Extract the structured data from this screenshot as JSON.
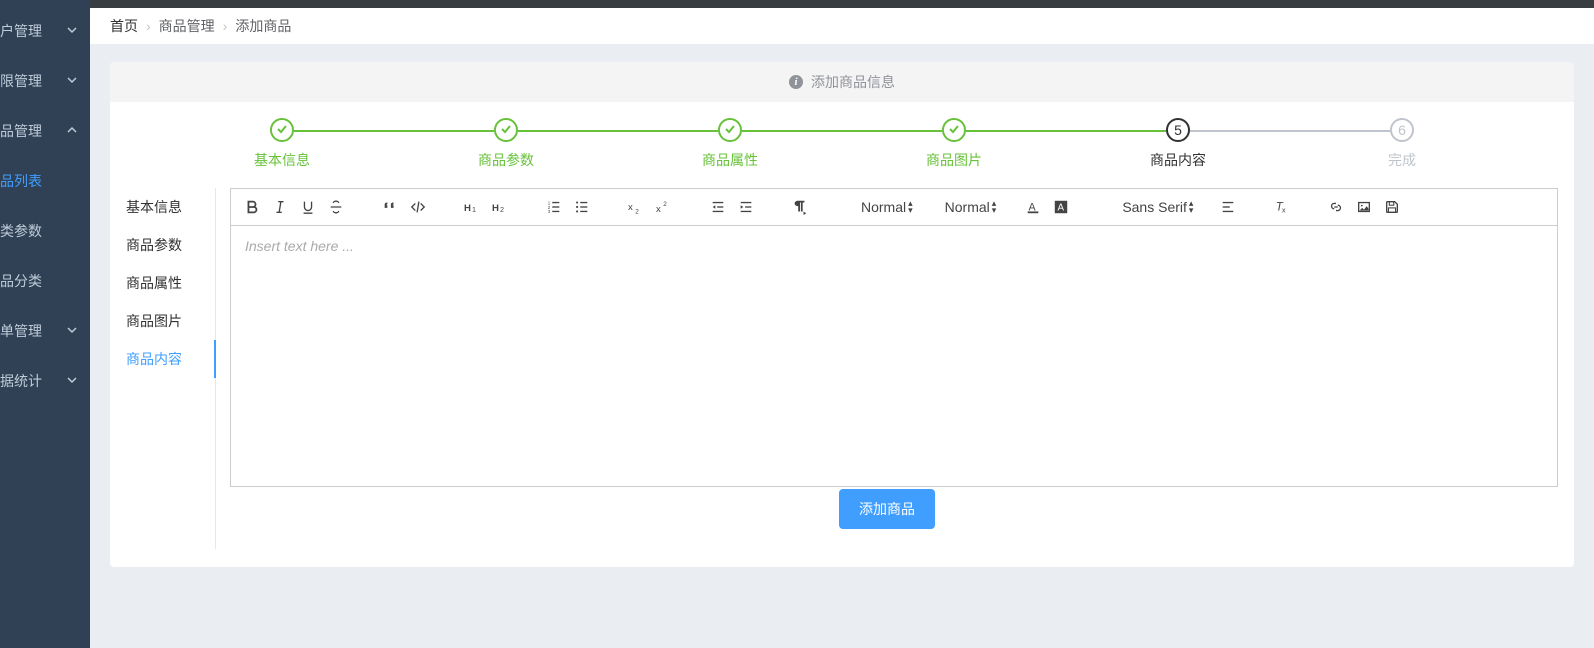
{
  "sidebar": {
    "items": [
      {
        "label": "户管理",
        "expandable": true,
        "active": false
      },
      {
        "label": "限管理",
        "expandable": true,
        "active": false
      },
      {
        "label": "品管理",
        "expandable": true,
        "active": false,
        "open": true
      },
      {
        "label": "品列表",
        "expandable": false,
        "active": true
      },
      {
        "label": "类参数",
        "expandable": false,
        "active": false
      },
      {
        "label": "品分类",
        "expandable": false,
        "active": false
      },
      {
        "label": "单管理",
        "expandable": true,
        "active": false
      },
      {
        "label": "据统计",
        "expandable": true,
        "active": false
      }
    ]
  },
  "breadcrumb": {
    "home": "首页",
    "mid": "商品管理",
    "last": "添加商品"
  },
  "alert": {
    "text": "添加商品信息"
  },
  "steps": [
    {
      "label": "基本信息",
      "state": "done"
    },
    {
      "label": "商品参数",
      "state": "done"
    },
    {
      "label": "商品属性",
      "state": "done"
    },
    {
      "label": "商品图片",
      "state": "done"
    },
    {
      "label": "商品内容",
      "state": "current",
      "num": "5"
    },
    {
      "label": "完成",
      "state": "future",
      "num": "6"
    }
  ],
  "tabs": [
    {
      "label": "基本信息"
    },
    {
      "label": "商品参数"
    },
    {
      "label": "商品属性"
    },
    {
      "label": "商品图片"
    },
    {
      "label": "商品内容"
    }
  ],
  "activeTab": 4,
  "editor": {
    "placeholder": "Insert text here ...",
    "pickers": {
      "header": "Normal",
      "size": "Normal",
      "font": "Sans Serif"
    }
  },
  "submitLabel": "添加商品"
}
